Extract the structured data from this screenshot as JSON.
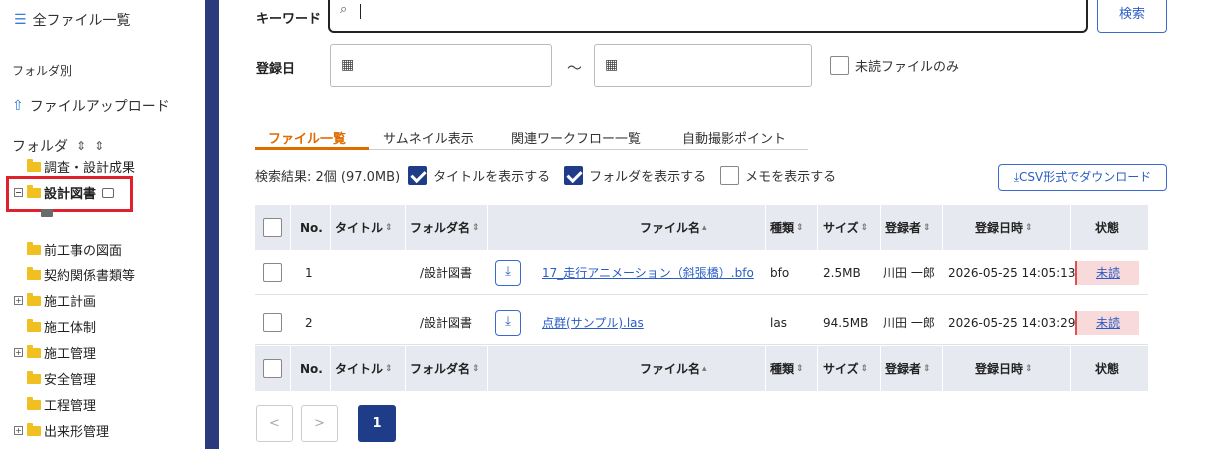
{
  "sidebar": {
    "all_files": "全ファイル一覧",
    "section_by_folder": "フォルダ別",
    "upload": "ファイルアップロード",
    "folder_header": "フォルダ",
    "tree": [
      {
        "label": "調査・設計成果",
        "expander": false
      },
      {
        "label": "設計図書",
        "expander": true,
        "selected": true
      },
      {
        "label": "前工事の図面",
        "expander": false
      },
      {
        "label": "契約関係書類等",
        "expander": false
      },
      {
        "label": "施工計画",
        "expander": true
      },
      {
        "label": "施工体制",
        "expander": false
      },
      {
        "label": "施工管理",
        "expander": true
      },
      {
        "label": "安全管理",
        "expander": false
      },
      {
        "label": "工程管理",
        "expander": false
      },
      {
        "label": "出来形管理",
        "expander": true
      }
    ]
  },
  "search": {
    "keyword_label": "キーワード",
    "keyword_value": "",
    "search_button": "検索",
    "date_label": "登録日",
    "date_from": "",
    "date_to": "",
    "range_sep": "〜",
    "unread_only_label": "未読ファイルのみ",
    "unread_only_checked": false
  },
  "tabs": [
    {
      "label": "ファイル一覧",
      "active": true
    },
    {
      "label": "サムネイル表示",
      "active": false
    },
    {
      "label": "関連ワークフロー一覧",
      "active": false
    },
    {
      "label": "自動撮影ポイント",
      "active": false
    }
  ],
  "results": {
    "summary": "検索結果: 2個 (97.0MB)",
    "show_title_label": "タイトルを表示する",
    "show_title_checked": true,
    "show_folder_label": "フォルダを表示する",
    "show_folder_checked": true,
    "show_memo_label": "メモを表示する",
    "show_memo_checked": false,
    "csv_button": "CSV形式でダウンロード"
  },
  "table": {
    "columns": {
      "no": "No.",
      "title": "タイトル",
      "folder": "フォルダ名",
      "file": "ファイル名",
      "type": "種類",
      "size": "サイズ",
      "registrant": "登録者",
      "datetime": "登録日時",
      "status": "状態"
    },
    "rows": [
      {
        "no": "1",
        "title": "",
        "folder": "/設計図書",
        "file": "17_走行アニメーション（斜張橋）.bfo",
        "type": "bfo",
        "size": "2.5MB",
        "registrant": "川田 一郎",
        "datetime": "2026-05-25 14:05:13",
        "status": "未読"
      },
      {
        "no": "2",
        "title": "",
        "folder": "/設計図書",
        "file": "点群(サンプル).las",
        "type": "las",
        "size": "94.5MB",
        "registrant": "川田 一郎",
        "datetime": "2026-05-25 14:03:29",
        "status": "未読"
      }
    ]
  },
  "pager": {
    "prev": "<",
    "next": ">",
    "current": "1"
  },
  "colors": {
    "accent_navy": "#1f3c88",
    "tab_orange": "#e06b00",
    "link_blue": "#2a5cc8",
    "unread_bg": "#f8dada",
    "highlight_red": "#e0202a"
  }
}
